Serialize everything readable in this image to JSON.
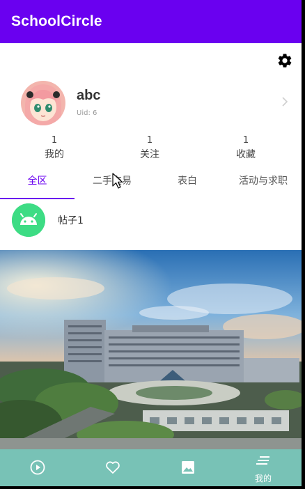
{
  "app": {
    "title": "SchoolCircle"
  },
  "colors": {
    "appbar": "#6a00f0",
    "accent": "#6a00f0",
    "bottom_nav": "#78c2b6",
    "post_avatar": "#3ddc84"
  },
  "icons": {
    "settings": "gear-icon",
    "profile_chevron": "chevron-right-icon",
    "nav": [
      "play-circle-icon",
      "heart-icon",
      "image-icon",
      "menu-lines-icon"
    ]
  },
  "profile": {
    "username": "abc",
    "uid": "Uid: 6"
  },
  "stats": [
    {
      "count": "1",
      "label": "我的"
    },
    {
      "count": "1",
      "label": "关注"
    },
    {
      "count": "1",
      "label": "收藏"
    }
  ],
  "tabs": [
    {
      "label": "全区",
      "active": true
    },
    {
      "label": "二手交易",
      "active": false
    },
    {
      "label": "表白",
      "active": false
    },
    {
      "label": "活动与求职",
      "active": false
    }
  ],
  "post": {
    "title": "帖子1"
  },
  "bottom_nav": {
    "items": [
      {
        "label": ""
      },
      {
        "label": ""
      },
      {
        "label": ""
      },
      {
        "label": "我的"
      }
    ]
  }
}
